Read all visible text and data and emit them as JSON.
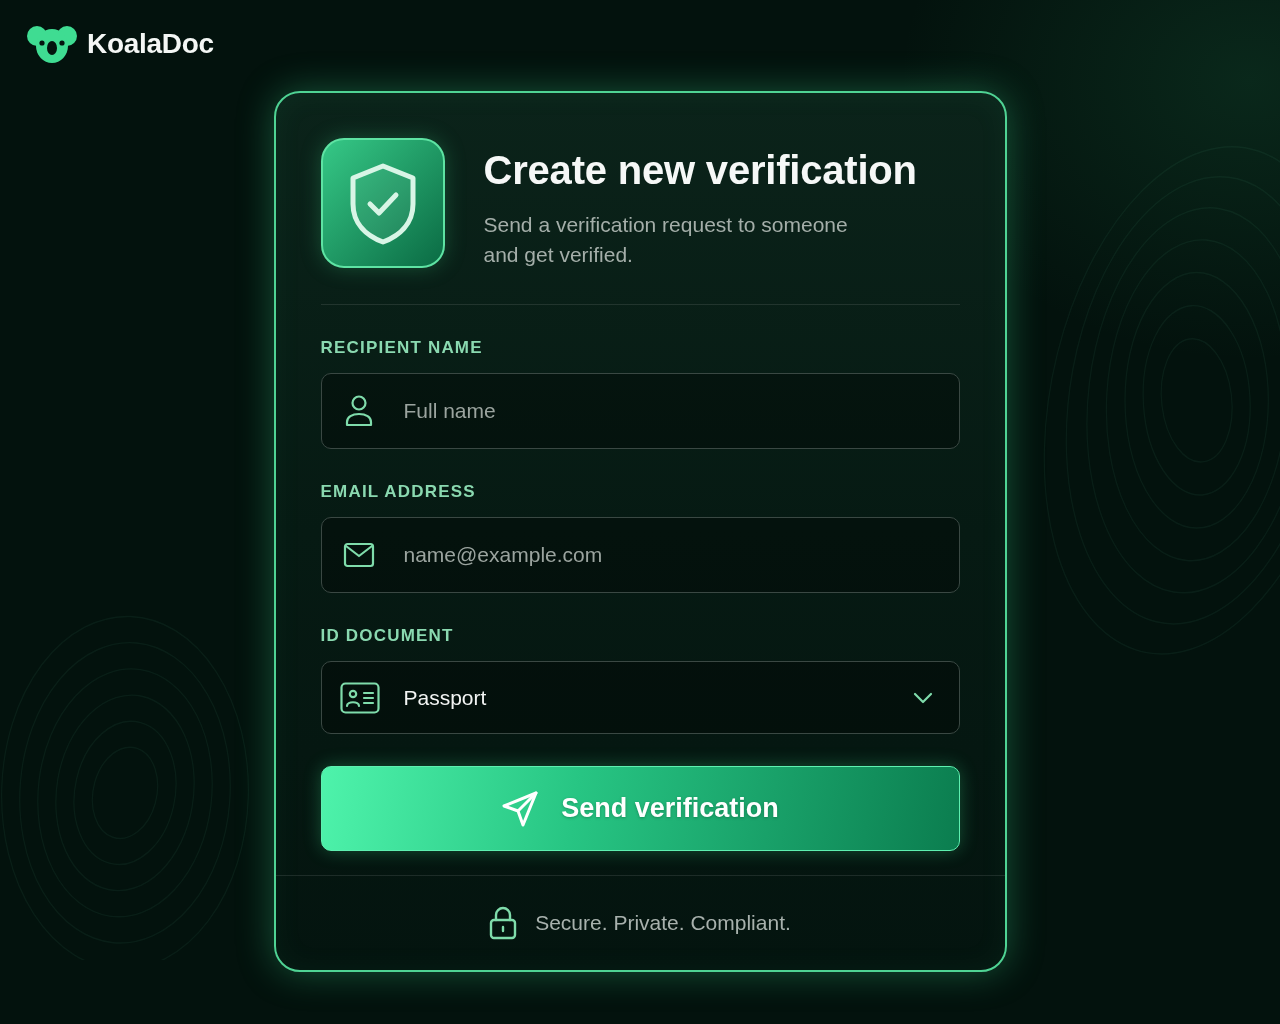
{
  "brand": {
    "name": "KoalaDoc"
  },
  "header": {
    "title": "Create new verification",
    "subtitle": "Send a verification request to someone and get verified."
  },
  "fields": [
    {
      "kind": "text",
      "label": "RECIPIENT NAME",
      "placeholder": "Full name"
    },
    {
      "kind": "email",
      "label": "EMAIL ADDRESS",
      "placeholder": "name@example.com"
    },
    {
      "kind": "select",
      "label": "ID DOCUMENT",
      "value": "Passport"
    }
  ],
  "submit": {
    "label": "Send verification"
  },
  "footer": {
    "text": "Secure. Private. Compliant."
  }
}
